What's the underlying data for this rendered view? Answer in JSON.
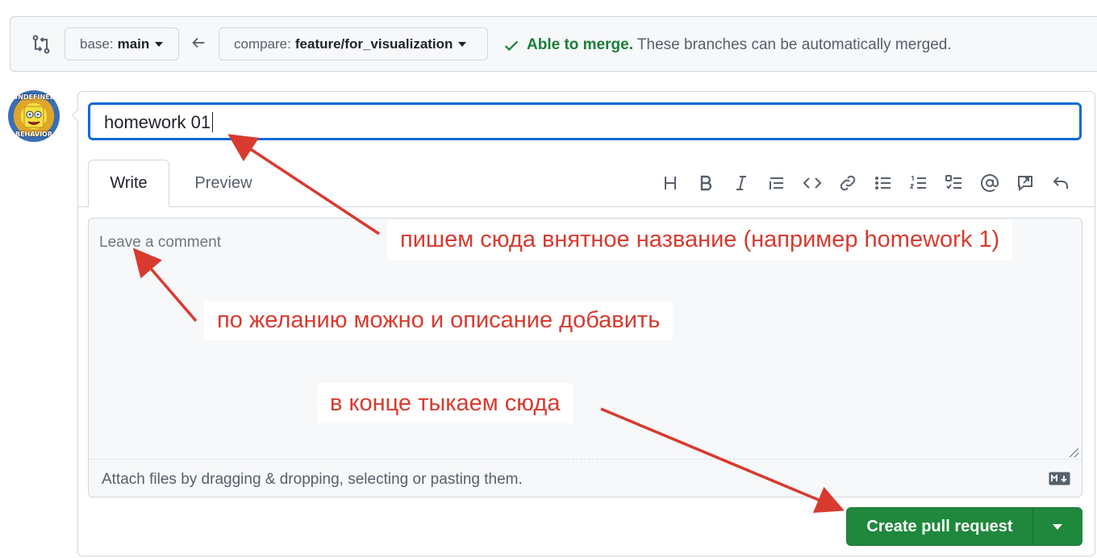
{
  "compare": {
    "base_label": "base:",
    "base_value": "main",
    "compare_label": "compare:",
    "compare_value": "feature/for_visualization",
    "merge_status": "Able to merge.",
    "merge_detail": "These branches can be automatically merged."
  },
  "avatar": {
    "top_text": "UNDEFINED",
    "bottom_text": "BEHAVIOR"
  },
  "form": {
    "title_value": "homework 01",
    "tabs": [
      {
        "label": "Write",
        "selected": true
      },
      {
        "label": "Preview",
        "selected": false
      }
    ],
    "toolbar_icons": [
      "heading-icon",
      "bold-icon",
      "italic-icon",
      "quote-icon",
      "code-icon",
      "link-icon",
      "unordered-list-icon",
      "ordered-list-icon",
      "task-list-icon",
      "mention-icon",
      "reference-icon",
      "undo-icon"
    ],
    "comment_placeholder": "Leave a comment",
    "attach_hint": "Attach files by dragging & dropping, selecting or pasting them.",
    "submit_label": "Create pull request"
  },
  "annotations": {
    "title_hint": "пишем сюда внятное название (например homework 1)",
    "description_hint": "по желанию можно и описание добавить",
    "submit_hint": "в конце тыкаем сюда",
    "color": "#d93a2f"
  },
  "colors": {
    "accent": "#0969da",
    "success": "#1a7f37",
    "button_green": "#1f883d"
  }
}
